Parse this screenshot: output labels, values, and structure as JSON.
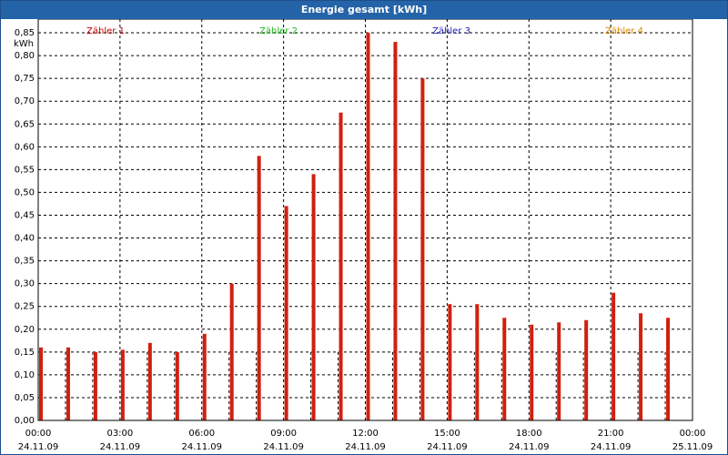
{
  "window": {
    "title": "Energie gesamt [kWh]"
  },
  "colors": {
    "bar": "#d02010",
    "zaehler1": "#cc0000",
    "zaehler2": "#22bb22",
    "zaehler3": "#2222bb",
    "zaehler4": "#dd8800"
  },
  "chart_data": {
    "type": "bar",
    "title": "Energie gesamt [kWh]",
    "ylabel": "kWh",
    "xlabel": "",
    "ylim": [
      0,
      0.88
    ],
    "yticks": [
      "0,00",
      "0,05",
      "0,10",
      "0,15",
      "0,20",
      "0,25",
      "0,30",
      "0,35",
      "0,40",
      "0,45",
      "0,50",
      "0,55",
      "0,60",
      "0,65",
      "0,70",
      "0,75",
      "0,80",
      "0,85"
    ],
    "x_tick_times": [
      "00:00",
      "03:00",
      "06:00",
      "09:00",
      "12:00",
      "15:00",
      "18:00",
      "21:00",
      "00:00"
    ],
    "x_tick_dates": [
      "24.11.09",
      "24.11.09",
      "24.11.09",
      "24.11.09",
      "24.11.09",
      "24.11.09",
      "24.11.09",
      "24.11.09",
      "25.11.09"
    ],
    "hours": [
      0,
      1,
      2,
      3,
      4,
      5,
      6,
      7,
      8,
      9,
      10,
      11,
      12,
      13,
      14,
      15,
      16,
      17,
      18,
      19,
      20,
      21,
      22,
      23
    ],
    "values": [
      0.16,
      0.16,
      0.15,
      0.155,
      0.17,
      0.15,
      0.19,
      0.3,
      0.58,
      0.47,
      0.54,
      0.675,
      0.85,
      0.83,
      0.75,
      0.255,
      0.255,
      0.225,
      0.21,
      0.215,
      0.22,
      0.28,
      0.235,
      0.225
    ],
    "legend": [
      "Zähler 1",
      "Zähler 2",
      "Zähler 3",
      "Zähler 4"
    ],
    "grid": true
  }
}
